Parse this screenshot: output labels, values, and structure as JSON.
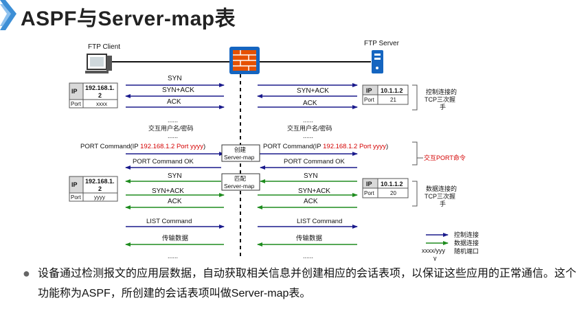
{
  "title": "ASPF与Server-map表",
  "client_label": "FTP Client",
  "server_label": "FTP Server",
  "tables": {
    "client_ctrl": {
      "h1": "IP",
      "v1": "192.168.1.2",
      "h2": "Port",
      "v2": "xxxx"
    },
    "client_data": {
      "h1": "IP",
      "v1": "192.168.1.2",
      "h2": "Port",
      "v2": "yyyy"
    },
    "server_ctrl": {
      "h1": "IP",
      "v1": "10.1.1.2",
      "h2": "Port",
      "v2": "21"
    },
    "server_data": {
      "h1": "IP",
      "v1": "10.1.1.2",
      "h2": "Port",
      "v2": "20"
    }
  },
  "v1_split": [
    "192.168.1.",
    "2"
  ],
  "msgs": {
    "syn": "SYN",
    "synack": "SYN+ACK",
    "ack": "ACK",
    "dots": "......",
    "userpass": "交互用户名/密码",
    "port_cmd_prefix": "PORT Command(IP ",
    "port_cmd_red": "192.168.1.2 Port yyyy",
    "port_cmd_suffix": ")",
    "port_ok": "PORT Command OK",
    "list_cmd": "LIST Command",
    "transfer": "传输数据"
  },
  "fw_labels": {
    "create": [
      "创建",
      "Server-map"
    ],
    "match": [
      "匹配",
      "Server-map"
    ]
  },
  "annotations": {
    "ctrl_handshake": [
      "控制连接的",
      "TCP三次握",
      "手"
    ],
    "port_exchange": "交互PORT命令",
    "data_handshake": [
      "数据连接的",
      "TCP三次握",
      "手"
    ]
  },
  "legend": {
    "ctrl": "控制连接",
    "data": "数据连接",
    "random_port": "随机端口",
    "xy": [
      "xxxx/yyy",
      "y"
    ]
  },
  "colors": {
    "ctrl": "#1a1a8c",
    "data": "#1e8c1e",
    "red": "#d40000",
    "fw": "#1565c0",
    "accent": "#3d8fd6"
  },
  "bullet": "设备通过检测报文的应用层数据，自动获取相关信息并创建相应的会话表项，以保证这些应用的正常通信。这个功能称为ASPF，所创建的会话表项叫做Server-map表。"
}
